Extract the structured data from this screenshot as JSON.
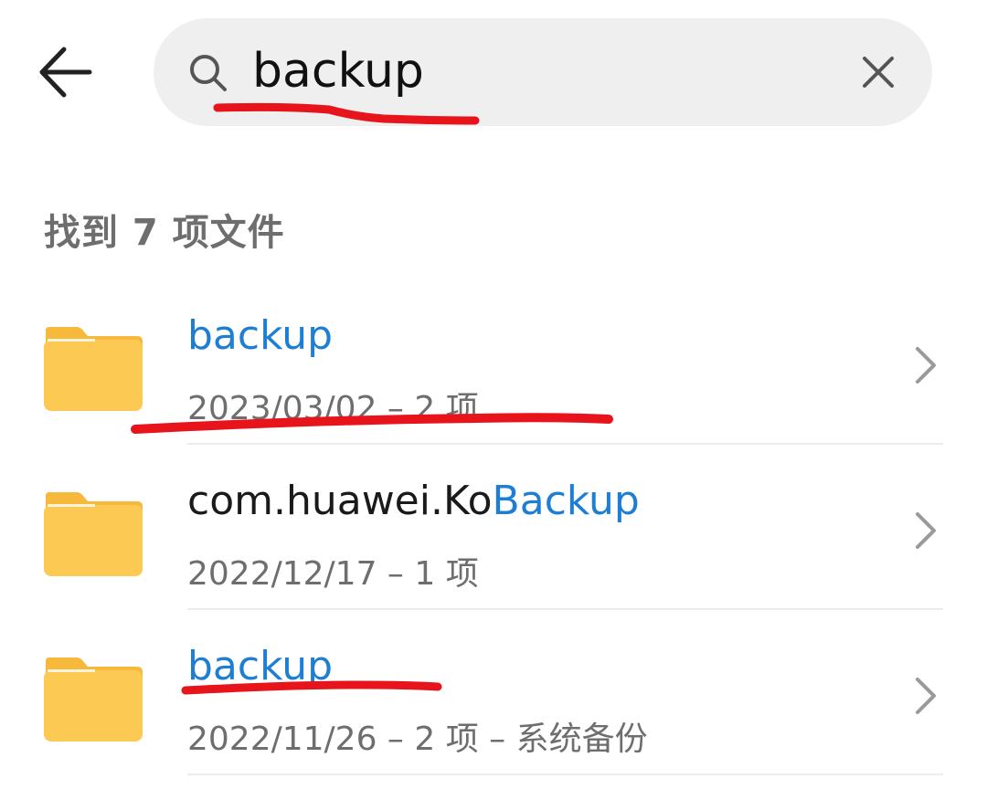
{
  "search": {
    "query": "backup",
    "icons": {
      "back": "arrow-left-icon",
      "search": "search-icon",
      "clear": "close-icon"
    }
  },
  "results": {
    "count_label": "找到 7 项文件",
    "items": [
      {
        "name_pre": "",
        "name_hl": "backup",
        "meta": "2023/03/02 – 2 项"
      },
      {
        "name_pre": "com.huawei.Ko",
        "name_hl": "Backup",
        "meta": "2022/12/17 – 1 项"
      },
      {
        "name_pre": "",
        "name_hl": "backup",
        "meta": "2022/11/26 – 2 项 – 系统备份"
      }
    ]
  },
  "colors": {
    "highlight": "#1d7ed3",
    "folder": "#fcc953",
    "folder_tab": "#f6b93c",
    "annotation": "#e8141c",
    "search_bg": "#efefef",
    "muted_text": "#6e6e6e"
  }
}
